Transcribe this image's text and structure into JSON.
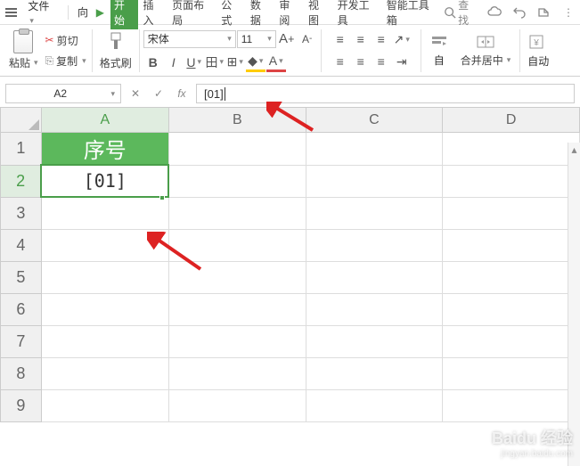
{
  "menu": {
    "file": "文件",
    "search_placeholder": "查找"
  },
  "tabs": {
    "start": "开始",
    "insert": "插入",
    "layout": "页面布局",
    "formula": "公式",
    "data": "数据",
    "review": "审阅",
    "view": "视图",
    "dev": "开发工具",
    "toolbox": "智能工具箱"
  },
  "ribbon": {
    "paste": "粘贴",
    "cut": "剪切",
    "copy": "复制",
    "format_painter": "格式刷",
    "font_name": "宋体",
    "font_size": "11",
    "wrap": "自",
    "merge": "合并居中",
    "auto": "自动"
  },
  "name_box": "A2",
  "formula": "[01]",
  "cols": [
    "A",
    "B",
    "C",
    "D"
  ],
  "rows": [
    "1",
    "2",
    "3",
    "4",
    "5",
    "6",
    "7",
    "8",
    "9"
  ],
  "cells": {
    "A1": "序号",
    "A2": "[01]"
  },
  "watermark": {
    "brand": "Baidu 经验",
    "sub": "jingyan.baidu.com"
  }
}
